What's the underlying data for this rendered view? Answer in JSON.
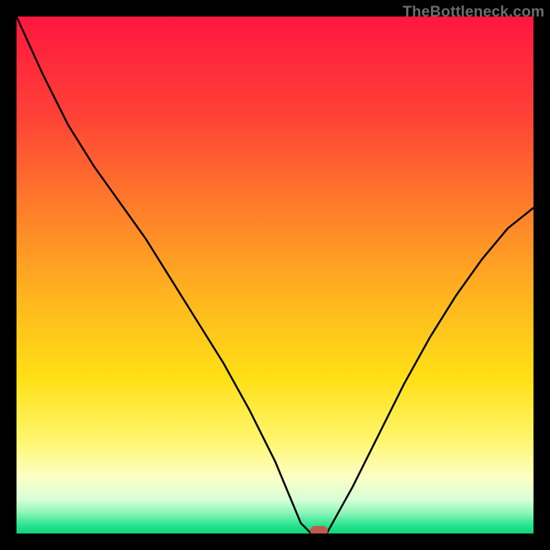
{
  "watermark": "TheBottleneck.com",
  "chart_data": {
    "type": "line",
    "title": "",
    "xlabel": "",
    "ylabel": "",
    "xlim": [
      0,
      100
    ],
    "ylim": [
      0,
      100
    ],
    "grid": false,
    "legend": false,
    "series": [
      {
        "name": "bottleneck-curve",
        "x": [
          0,
          5,
          10,
          15,
          20,
          25,
          30,
          35,
          40,
          45,
          50,
          55,
          57,
          60,
          65,
          70,
          75,
          80,
          85,
          90,
          95,
          100
        ],
        "y": [
          100,
          89,
          79,
          71,
          64,
          57,
          49,
          41,
          33,
          24,
          14,
          2,
          0,
          0,
          9,
          19,
          29,
          38,
          46,
          53,
          59,
          63
        ],
        "color": "#000000"
      }
    ],
    "marker": {
      "x": 58.5,
      "y": 0.5,
      "width_pct": 3.5,
      "height_pct": 1.8,
      "color": "#c15a4d"
    },
    "background_gradient_stops": [
      {
        "pos": 0.0,
        "color": "#ff173f"
      },
      {
        "pos": 0.18,
        "color": "#ff3e37"
      },
      {
        "pos": 0.36,
        "color": "#ff7a2b"
      },
      {
        "pos": 0.54,
        "color": "#ffb41f"
      },
      {
        "pos": 0.7,
        "color": "#ffe016"
      },
      {
        "pos": 0.82,
        "color": "#fff66e"
      },
      {
        "pos": 0.89,
        "color": "#fdffc4"
      },
      {
        "pos": 0.935,
        "color": "#d6ffd6"
      },
      {
        "pos": 0.96,
        "color": "#8cf6b8"
      },
      {
        "pos": 0.985,
        "color": "#26e28e"
      },
      {
        "pos": 1.0,
        "color": "#10d47a"
      }
    ]
  }
}
